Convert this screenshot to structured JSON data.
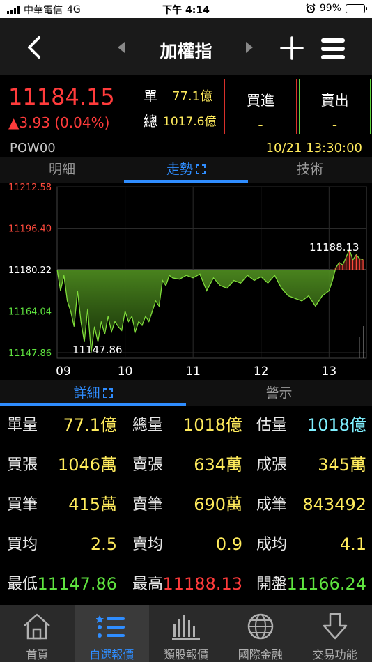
{
  "status_bar": {
    "carrier": "中華電信",
    "network": "4G",
    "time": "下午 4:14",
    "battery": "99%"
  },
  "nav": {
    "title": "加權指"
  },
  "quote": {
    "price": "11184.15",
    "change": "▲3.93 (0.04%)",
    "single_label": "單",
    "single_value": "77.1億",
    "total_label": "總",
    "total_value": "1017.6億",
    "buy_label": "買進",
    "buy_value": "-",
    "sell_label": "賣出",
    "sell_value": "-",
    "code": "POW00",
    "datetime": "10/21 13:30:00"
  },
  "tabs": [
    {
      "label": "明細"
    },
    {
      "label": "走勢"
    },
    {
      "label": "技術"
    }
  ],
  "chart_data": {
    "type": "area",
    "y_ticks": [
      "11212.58",
      "11196.40",
      "11180.22",
      "11164.04",
      "11147.86"
    ],
    "y_tick_values": [
      11212.58,
      11196.4,
      11180.22,
      11164.04,
      11147.86
    ],
    "x_ticks": [
      "09",
      "10",
      "11",
      "12",
      "13"
    ],
    "reference": 11180.22,
    "ylim": [
      11147.86,
      11212.58
    ],
    "high_label": "11188.13",
    "low_label": "11147.86",
    "grid": true,
    "x": [
      9.0,
      9.05,
      9.1,
      9.15,
      9.2,
      9.25,
      9.3,
      9.35,
      9.4,
      9.45,
      9.5,
      9.55,
      9.6,
      9.65,
      9.7,
      9.75,
      9.8,
      9.85,
      9.9,
      9.95,
      10.0,
      10.05,
      10.1,
      10.15,
      10.2,
      10.25,
      10.3,
      10.35,
      10.4,
      10.45,
      10.5,
      10.55,
      10.6,
      10.65,
      10.7,
      10.8,
      10.9,
      11.0,
      11.1,
      11.2,
      11.3,
      11.4,
      11.5,
      11.6,
      11.7,
      11.8,
      11.9,
      12.0,
      12.1,
      12.2,
      12.3,
      12.4,
      12.5,
      12.6,
      12.7,
      12.8,
      12.9,
      13.0,
      13.05,
      13.1,
      13.15,
      13.2,
      13.25,
      13.3,
      13.35,
      13.4,
      13.45,
      13.5
    ],
    "values": [
      11180.2,
      11172.0,
      11178.0,
      11168.0,
      11164.0,
      11158.0,
      11172.0,
      11160.0,
      11152.0,
      11165.0,
      11148.0,
      11158.0,
      11152.0,
      11160.0,
      11155.0,
      11162.0,
      11156.0,
      11160.0,
      11158.0,
      11156.5,
      11164.0,
      11160.0,
      11162.0,
      11156.0,
      11160.0,
      11158.5,
      11162.0,
      11160.0,
      11164.0,
      11168.0,
      11166.0,
      11176.0,
      11174.0,
      11178.0,
      11177.0,
      11176.5,
      11178.0,
      11177.0,
      11178.5,
      11172.0,
      11177.0,
      11174.0,
      11173.0,
      11176.0,
      11175.0,
      11178.0,
      11176.0,
      11177.5,
      11175.0,
      11178.0,
      11173.0,
      11170.0,
      11169.0,
      11168.0,
      11170.0,
      11166.0,
      11170.0,
      11172.0,
      11176.0,
      11181.0,
      11183.0,
      11182.0,
      11185.0,
      11188.1,
      11184.0,
      11186.0,
      11184.5,
      11184.15
    ],
    "xlim": [
      9.0,
      13.55
    ]
  },
  "subtabs": {
    "detail": "詳細",
    "alert": "警示"
  },
  "stats": [
    [
      {
        "k": "單量",
        "v": "77.1億",
        "c": ""
      },
      {
        "k": "總量",
        "v": "1018億",
        "c": ""
      },
      {
        "k": "估量",
        "v": "1018億",
        "c": "cyan"
      }
    ],
    [
      {
        "k": "買張",
        "v": "1046萬",
        "c": ""
      },
      {
        "k": "賣張",
        "v": "634萬",
        "c": ""
      },
      {
        "k": "成張",
        "v": "345萬",
        "c": ""
      }
    ],
    [
      {
        "k": "買筆",
        "v": "415萬",
        "c": ""
      },
      {
        "k": "賣筆",
        "v": "690萬",
        "c": ""
      },
      {
        "k": "成筆",
        "v": "843492",
        "c": ""
      }
    ],
    [
      {
        "k": "買均",
        "v": "2.5",
        "c": ""
      },
      {
        "k": "賣均",
        "v": "0.9",
        "c": ""
      },
      {
        "k": "成均",
        "v": "4.1",
        "c": ""
      }
    ],
    [
      {
        "k": "最低",
        "v": "11147.86",
        "c": "green"
      },
      {
        "k": "最高",
        "v": "11188.13",
        "c": "red"
      },
      {
        "k": "開盤",
        "v": "11166.24",
        "c": "green"
      }
    ]
  ],
  "bottom_nav": [
    {
      "label": "首頁",
      "icon": "home-icon"
    },
    {
      "label": "自選報價",
      "icon": "list-icon"
    },
    {
      "label": "類股報價",
      "icon": "bar-chart-icon"
    },
    {
      "label": "國際金融",
      "icon": "globe-icon"
    },
    {
      "label": "交易功能",
      "icon": "arrow-down-icon"
    }
  ],
  "colors": {
    "up": "#ff3b3b",
    "down": "#5fe33f",
    "accent": "#2f8dff",
    "value": "#ffeb5c"
  }
}
